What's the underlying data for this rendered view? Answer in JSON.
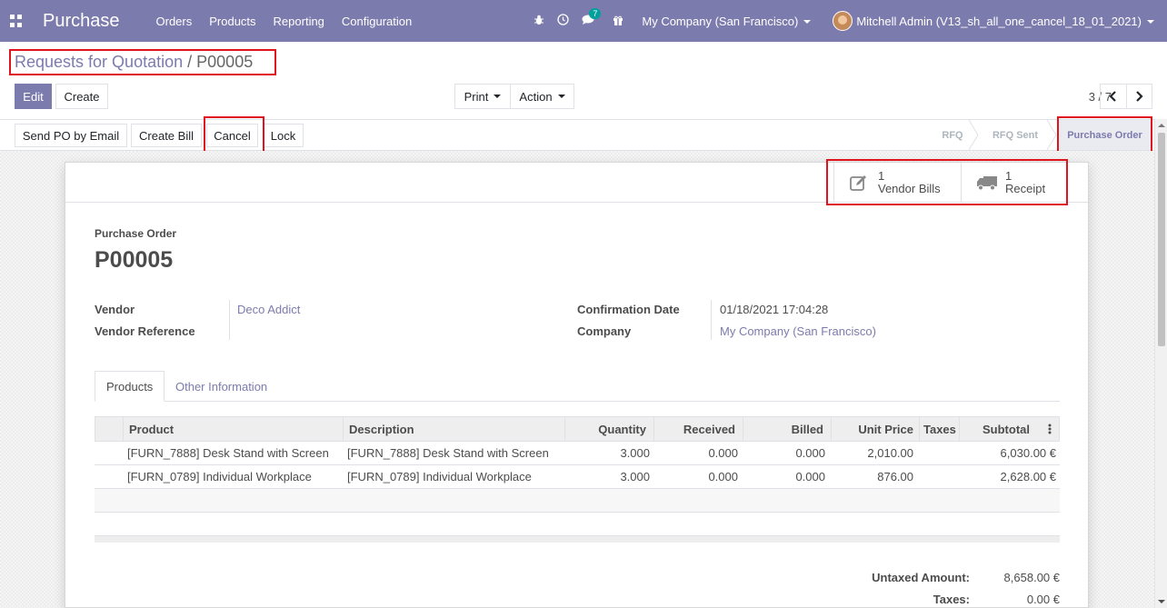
{
  "navbar": {
    "app_name": "Purchase",
    "menu": [
      "Orders",
      "Products",
      "Reporting",
      "Configuration"
    ],
    "message_count": "7",
    "company": "My Company (San Francisco)",
    "user": "Mitchell Admin (V13_sh_all_one_cancel_18_01_2021)",
    "icons": [
      "apps-icon",
      "bug-icon",
      "clock-icon",
      "chat-icon",
      "gift-icon"
    ]
  },
  "breadcrumb": {
    "parent": "Requests for Quotation",
    "separator": "/",
    "current": "P00005"
  },
  "actions": {
    "edit": "Edit",
    "create": "Create",
    "print": "Print",
    "action": "Action"
  },
  "pager": {
    "value": "3 / 7"
  },
  "header_buttons": {
    "send_po": "Send PO by Email",
    "create_bill": "Create Bill",
    "cancel": "Cancel",
    "lock": "Lock"
  },
  "stages": [
    "RFQ",
    "RFQ Sent",
    "Purchase Order"
  ],
  "active_stage": "Purchase Order",
  "smart_buttons": [
    {
      "count": "1",
      "label": "Vendor Bills",
      "icon": "pencil-square-icon"
    },
    {
      "count": "1",
      "label": "Receipt",
      "icon": "truck-icon"
    }
  ],
  "form": {
    "doc_type": "Purchase Order",
    "name": "P00005",
    "vendor_label": "Vendor",
    "vendor": "Deco Addict",
    "vendor_ref_label": "Vendor Reference",
    "confirmation_label": "Confirmation Date",
    "confirmation_date": "01/18/2021 17:04:28",
    "company_label": "Company",
    "company": "My Company (San Francisco)"
  },
  "tabs": [
    "Products",
    "Other Information"
  ],
  "table": {
    "columns": [
      "Product",
      "Description",
      "Quantity",
      "Received",
      "Billed",
      "Unit Price",
      "Taxes",
      "Subtotal"
    ],
    "rows": [
      {
        "product": "[FURN_7888] Desk Stand with Screen",
        "description": "[FURN_7888] Desk Stand with Screen",
        "quantity": "3.000",
        "received": "0.000",
        "billed": "0.000",
        "unit_price": "2,010.00",
        "taxes": "",
        "subtotal": "6,030.00 €"
      },
      {
        "product": "[FURN_0789] Individual Workplace",
        "description": "[FURN_0789] Individual Workplace",
        "quantity": "3.000",
        "received": "0.000",
        "billed": "0.000",
        "unit_price": "876.00",
        "taxes": "",
        "subtotal": "2,628.00 €"
      }
    ]
  },
  "totals": {
    "untaxed_label": "Untaxed Amount:",
    "untaxed": "8,658.00 €",
    "taxes_label": "Taxes:",
    "taxes": "0.00 €"
  },
  "colors": {
    "brand": "#7c7bad",
    "highlight": "#e0141e"
  }
}
